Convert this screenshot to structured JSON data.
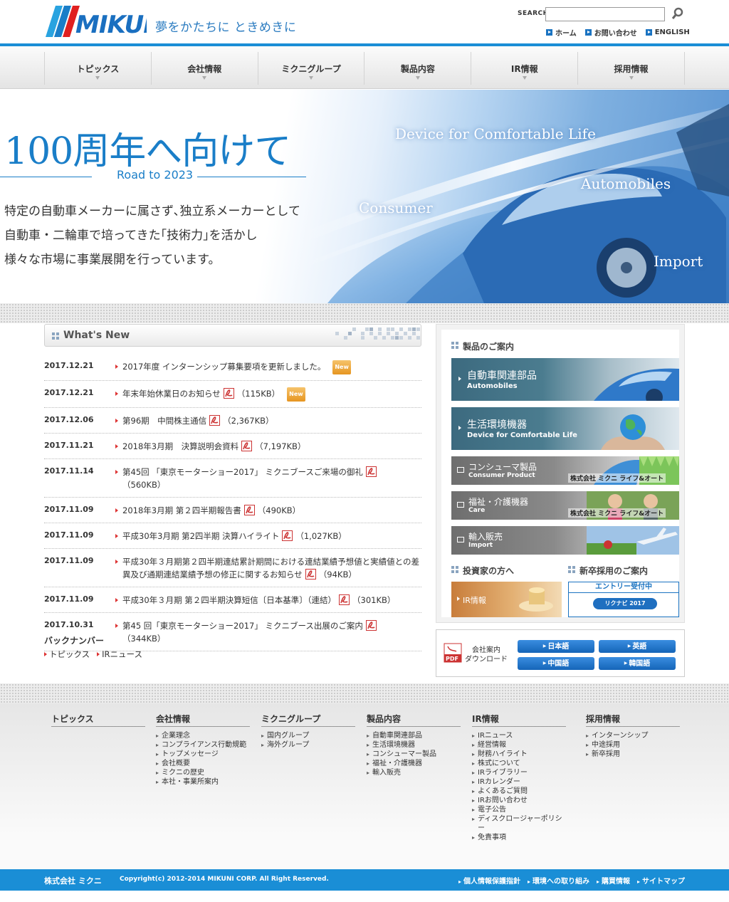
{
  "header": {
    "tagline": "夢をかたちに ときめきに",
    "search_label": "SEARCH",
    "search_value": "",
    "util_links": [
      "ホーム",
      "お問い合わせ",
      "ENGLISH"
    ]
  },
  "nav": [
    "トピックス",
    "会社情報",
    "ミクニグループ",
    "製品内容",
    "IR情報",
    "採用情報"
  ],
  "hero": {
    "title": "100周年へ向けて",
    "subtitle": "Road to 2023",
    "body": [
      "特定の自動車メーカーに属さず､独立系メーカーとして",
      "自動車・二輪車で培ってきた｢技術力｣を活かし",
      "様々な市場に事業展開を行っています。"
    ],
    "words": [
      "Device for Comfortable Life",
      "Automobiles",
      "Consumer",
      "Import"
    ]
  },
  "whats_new": {
    "title": "What's New",
    "items": [
      {
        "date": "2017.12.21",
        "text": "2017年度 インターンシップ募集要項を更新しました。",
        "size": "",
        "pdf": false,
        "new": true
      },
      {
        "date": "2017.12.21",
        "text": "年末年始休業日のお知らせ",
        "size": "（115KB）",
        "pdf": true,
        "new": true
      },
      {
        "date": "2017.12.06",
        "text": "第96期　中間株主通信",
        "size": "（2,367KB）",
        "pdf": true,
        "new": false
      },
      {
        "date": "2017.11.21",
        "text": "2018年3月期　決算説明会資料",
        "size": "（7,197KB）",
        "pdf": true,
        "new": false
      },
      {
        "date": "2017.11.14",
        "text": "第45回 「東京モーターショー2017」 ミクニブースご来場の御礼",
        "size": "（560KB）",
        "pdf": true,
        "new": false
      },
      {
        "date": "2017.11.09",
        "text": "2018年3月期 第２四半期報告書",
        "size": "（490KB）",
        "pdf": true,
        "new": false
      },
      {
        "date": "2017.11.09",
        "text": "平成30年3月期 第2四半期 決算ハイライト",
        "size": "（1,027KB）",
        "pdf": true,
        "new": false
      },
      {
        "date": "2017.11.09",
        "text": "平成30年３月期第２四半期連結累計期間における連結業績予想値と実績値との差異及び通期連結業績予想の修正に関するお知らせ",
        "size": "（94KB）",
        "pdf": true,
        "new": false
      },
      {
        "date": "2017.11.09",
        "text": "平成30年３月期 第２四半期決算短信〔日本基準〕（連結）",
        "size": "（301KB）",
        "pdf": true,
        "new": false
      },
      {
        "date": "2017.10.31",
        "text": "第45 回「東京モーターショー2017」 ミクニブース出展のご案内",
        "size": "（344KB）",
        "pdf": true,
        "new": false
      }
    ],
    "new_label": "New",
    "backnumber_title": "バックナンバー",
    "backnumber_links": [
      "トピックス",
      "IRニュース"
    ]
  },
  "side": {
    "products_title": "製品のご案内",
    "products": [
      {
        "jp": "自動車関連部品",
        "en": "Automobiles",
        "big": true,
        "company": ""
      },
      {
        "jp": "生活環境機器",
        "en": "Device for Comfortable Life",
        "big": true,
        "company": ""
      },
      {
        "jp": "コンシューマ製品",
        "en": "Consumer Product",
        "big": false,
        "company": "株式会社 ミクニ ライフ&オート"
      },
      {
        "jp": "福祉・介護機器",
        "en": "Care",
        "big": false,
        "company": "株式会社 ミクニ ライフ&オート"
      },
      {
        "jp": "輸入販売",
        "en": "Import",
        "big": false,
        "company": ""
      }
    ],
    "investor_title": "投資家の方へ",
    "ir_label": "IR情報",
    "recruit_title": "新卒採用のご案内",
    "entry_label": "エントリー受付中",
    "rikunabi": "リクナビ 2017"
  },
  "download": {
    "label_line1": "会社案内",
    "label_line2": "ダウンロード",
    "buttons": [
      "日本語",
      "英語",
      "中国語",
      "韓国語"
    ]
  },
  "footer": {
    "columns": [
      {
        "title": "トピックス",
        "links": []
      },
      {
        "title": "会社情報",
        "links": [
          "企業理念",
          "コンプライアンス行動規範",
          "トップメッセージ",
          "会社概要",
          "ミクニの歴史",
          "本社・事業所案内"
        ]
      },
      {
        "title": "ミクニグループ",
        "links": [
          "国内グループ",
          "海外グループ"
        ]
      },
      {
        "title": "製品内容",
        "links": [
          "自動車関連部品",
          "生活環境機器",
          "コンシューマー製品",
          "福祉・介護機器",
          "輸入販売"
        ]
      },
      {
        "title": "IR情報",
        "links": [
          "IRニュース",
          "経営情報",
          "財務ハイライト",
          "株式について",
          "IRライブラリー",
          "IRカレンダー",
          "よくあるご質問",
          "IRお問い合わせ",
          "電子公告",
          "ディスクロージャーポリシー",
          "免責事項"
        ]
      },
      {
        "title": "採用情報",
        "links": [
          "インターンシップ",
          "中途採用",
          "新卒採用"
        ]
      }
    ],
    "company": "株式会社 ミクニ",
    "copyright": "Copyright(c) 2012-2014 MIKUNI CORP. All Right Reserved.",
    "bottom_links": [
      "個人情報保護指針",
      "環境への取り組み",
      "購買情報",
      "サイトマップ"
    ]
  },
  "colors": {
    "brand_blue": "#1a8ed6",
    "accent_red": "#d33"
  },
  "logo_text": "MIKUNI"
}
